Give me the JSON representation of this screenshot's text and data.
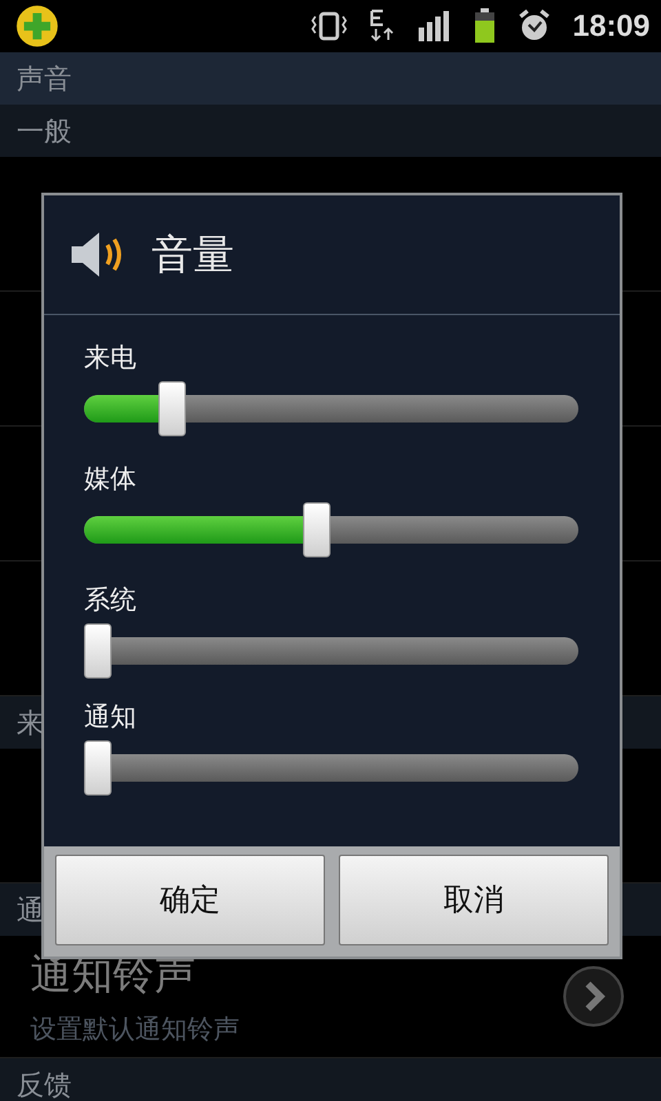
{
  "status_bar": {
    "time": "18:09"
  },
  "title": "声音",
  "sections": [
    {
      "header": "一般",
      "rows": [
        {},
        {},
        {},
        {}
      ]
    },
    {
      "header": "来",
      "rows": [
        {}
      ]
    },
    {
      "header": "通",
      "rows": [
        {
          "title": "通知铃声",
          "subtitle": "设置默认通知铃声"
        }
      ]
    },
    {
      "header": "反馈"
    }
  ],
  "dialog": {
    "title": "音量",
    "sliders": [
      {
        "label": "来电",
        "level": 0.16
      },
      {
        "label": "媒体",
        "level": 0.47
      },
      {
        "label": "系统",
        "level": 0
      },
      {
        "label": "通知",
        "level": 0
      }
    ],
    "buttons": [
      "确定",
      "取消"
    ]
  }
}
